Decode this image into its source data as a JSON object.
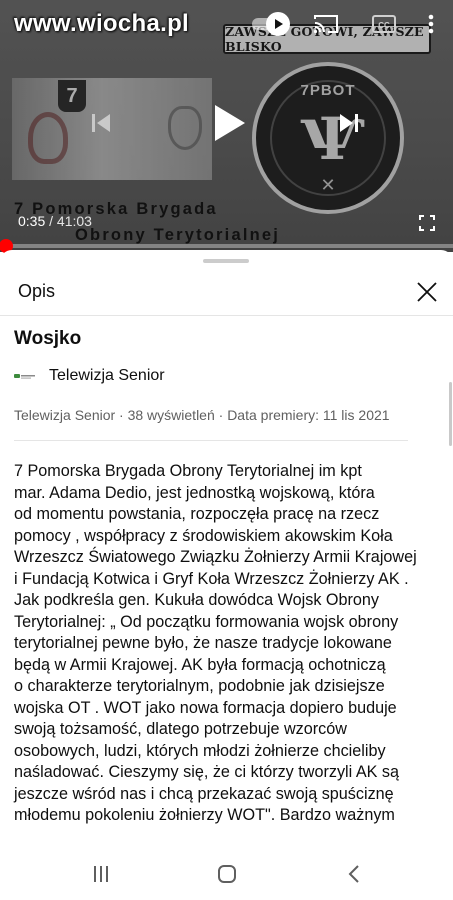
{
  "watermark": "www.wiocha.pl",
  "player": {
    "banner_text": "ZAWSZE GOTOWI, ZAWSZE BLISKO",
    "emblem_text": "7PBOT",
    "frame_title_line1": "7 Pomorska Brygada",
    "frame_title_line2": "Obrony Terytorialnej",
    "current_time": "0:35",
    "time_separator": " / ",
    "duration": "41:03",
    "progress_fraction": 0.014,
    "autoplay_on": true,
    "accent_color": "#ff0000",
    "icons": [
      "autoplay-toggle",
      "cast-icon",
      "closed-captions-icon",
      "more-vert-icon",
      "previous-icon",
      "play-icon",
      "next-icon",
      "fullscreen-icon"
    ]
  },
  "sheet": {
    "title": "Opis",
    "video_title": "Wosjko",
    "channel_name": "Telewizja Senior",
    "meta": "Telewizja Senior · 38 wyświetleń · Data premiery: 11 lis 2021",
    "description_lines": [
      "7 Pomorska Brygada Obrony Terytorialnej im kpt",
      "mar. Adama Dedio, jest jednostką wojskową, która",
      "od momentu powstania, rozpoczęła pracę na rzecz",
      "pomocy , współpracy z środowiskiem akowskim Koła",
      "Wrzeszcz Światowego Związku Żołnierzy Armii Krajowej",
      "i Fundacją Kotwica i Gryf Koła Wrzeszcz Żołnierzy AK  .",
      "Jak podkreśla gen. Kukuła dowódca Wojsk Obrony",
      "Terytorialnej: „ Od początku formowania wojsk obrony",
      "terytorialnej pewne było, że nasze tradycje lokowane",
      "będą w Armii Krajowej. AK była formacją ochotniczą",
      "o charakterze terytorialnym, podobnie jak dzisiejsze",
      "wojska OT . WOT jako nowa formacja dopiero buduje",
      "swoją tożsamość, dlatego potrzebuje wzorców",
      "osobowych, ludzi, których młodzi żołnierze chcieliby",
      "naśladować. Cieszymy się, że ci którzy tworzyli AK są",
      "jeszcze wśród nas i chcą przekazać swoją spuściznę",
      "młodemu pokoleniu żołnierzy WOT\".  Bardzo ważnym"
    ]
  },
  "navbar": {
    "icons": [
      "recent-apps-icon",
      "home-icon",
      "back-icon"
    ]
  }
}
